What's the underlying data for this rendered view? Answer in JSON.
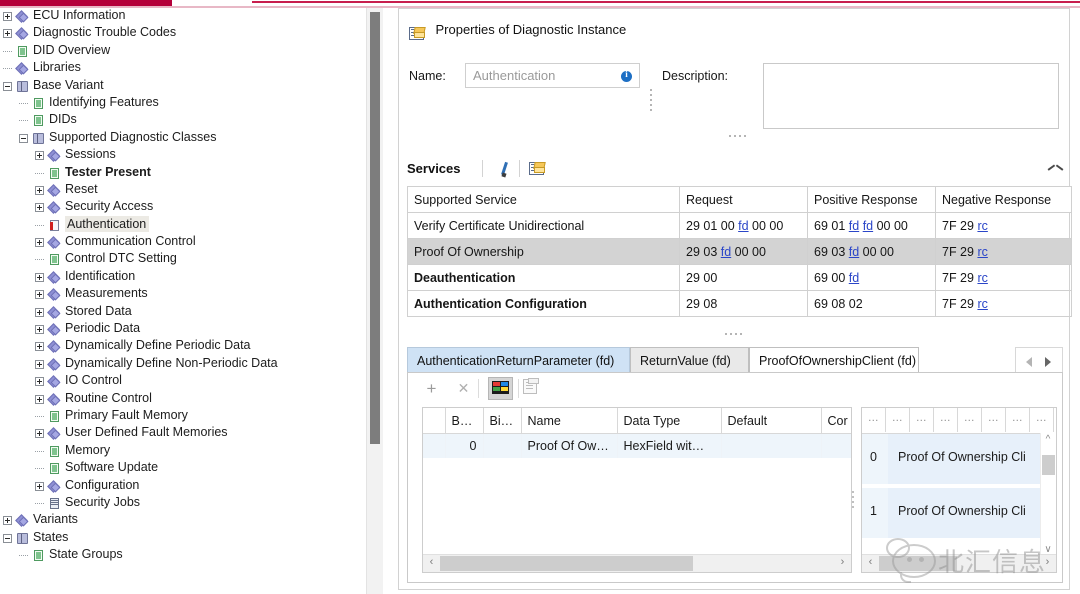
{
  "tree": {
    "items": [
      {
        "label": "ECU Information",
        "indent": 0,
        "toggle": "plus",
        "icon": "diamond-icon",
        "selected": false,
        "bold": false
      },
      {
        "label": "Diagnostic Trouble Codes",
        "indent": 0,
        "toggle": "plus",
        "icon": "diamond-icon",
        "selected": false,
        "bold": false
      },
      {
        "label": "DID Overview",
        "indent": 0,
        "toggle": "dash",
        "icon": "page-icon",
        "selected": false,
        "bold": false
      },
      {
        "label": "Libraries",
        "indent": 0,
        "toggle": "dash",
        "icon": "diamond-icon",
        "selected": false,
        "bold": false
      },
      {
        "label": "Base Variant",
        "indent": 0,
        "toggle": "minus",
        "icon": "book-icon",
        "selected": false,
        "bold": false
      },
      {
        "label": "Identifying Features",
        "indent": 1,
        "toggle": "dash",
        "icon": "page-icon",
        "selected": false,
        "bold": false
      },
      {
        "label": "DIDs",
        "indent": 1,
        "toggle": "dash",
        "icon": "page-icon",
        "selected": false,
        "bold": false
      },
      {
        "label": "Supported Diagnostic Classes",
        "indent": 1,
        "toggle": "minus",
        "icon": "book-icon",
        "selected": false,
        "bold": false
      },
      {
        "label": "Sessions",
        "indent": 2,
        "toggle": "plus",
        "icon": "diamond-icon",
        "selected": false,
        "bold": false
      },
      {
        "label": "Tester Present",
        "indent": 2,
        "toggle": "dash",
        "icon": "page-icon",
        "selected": false,
        "bold": true
      },
      {
        "label": "Reset",
        "indent": 2,
        "toggle": "plus",
        "icon": "diamond-icon",
        "selected": false,
        "bold": false
      },
      {
        "label": "Security Access",
        "indent": 2,
        "toggle": "plus",
        "icon": "diamond-icon",
        "selected": false,
        "bold": false
      },
      {
        "label": "Authentication",
        "indent": 2,
        "toggle": "dash",
        "icon": "page-red-icon",
        "selected": true,
        "bold": false
      },
      {
        "label": "Communication Control",
        "indent": 2,
        "toggle": "plus",
        "icon": "diamond-icon",
        "selected": false,
        "bold": false
      },
      {
        "label": "Control DTC Setting",
        "indent": 2,
        "toggle": "dash",
        "icon": "page-icon",
        "selected": false,
        "bold": false
      },
      {
        "label": "Identification",
        "indent": 2,
        "toggle": "plus",
        "icon": "diamond-icon",
        "selected": false,
        "bold": false
      },
      {
        "label": "Measurements",
        "indent": 2,
        "toggle": "plus",
        "icon": "diamond-icon",
        "selected": false,
        "bold": false
      },
      {
        "label": "Stored Data",
        "indent": 2,
        "toggle": "plus",
        "icon": "diamond-icon",
        "selected": false,
        "bold": false
      },
      {
        "label": "Periodic Data",
        "indent": 2,
        "toggle": "plus",
        "icon": "diamond-icon",
        "selected": false,
        "bold": false
      },
      {
        "label": "Dynamically Define Periodic Data",
        "indent": 2,
        "toggle": "plus",
        "icon": "diamond-icon",
        "selected": false,
        "bold": false
      },
      {
        "label": "Dynamically Define Non-Periodic Data",
        "indent": 2,
        "toggle": "plus",
        "icon": "diamond-icon",
        "selected": false,
        "bold": false
      },
      {
        "label": "IO Control",
        "indent": 2,
        "toggle": "plus",
        "icon": "diamond-icon",
        "selected": false,
        "bold": false
      },
      {
        "label": "Routine Control",
        "indent": 2,
        "toggle": "plus",
        "icon": "diamond-icon",
        "selected": false,
        "bold": false
      },
      {
        "label": "Primary Fault Memory",
        "indent": 2,
        "toggle": "dash",
        "icon": "page-icon",
        "selected": false,
        "bold": false
      },
      {
        "label": "User Defined Fault Memories",
        "indent": 2,
        "toggle": "plus",
        "icon": "diamond-icon",
        "selected": false,
        "bold": false
      },
      {
        "label": "Memory",
        "indent": 2,
        "toggle": "dash",
        "icon": "page-icon",
        "selected": false,
        "bold": false
      },
      {
        "label": "Software Update",
        "indent": 2,
        "toggle": "dash",
        "icon": "page-icon",
        "selected": false,
        "bold": false
      },
      {
        "label": "Configuration",
        "indent": 2,
        "toggle": "plus",
        "icon": "diamond-icon",
        "selected": false,
        "bold": false
      },
      {
        "label": "Security Jobs",
        "indent": 2,
        "toggle": "dash",
        "icon": "job-icon",
        "selected": false,
        "bold": false
      },
      {
        "label": "Variants",
        "indent": 0,
        "toggle": "plus",
        "icon": "diamond-icon",
        "selected": false,
        "bold": false
      },
      {
        "label": "States",
        "indent": 0,
        "toggle": "minus",
        "icon": "book-icon",
        "selected": false,
        "bold": false
      },
      {
        "label": "State Groups",
        "indent": 1,
        "toggle": "dash",
        "icon": "page-icon",
        "selected": false,
        "bold": false
      }
    ]
  },
  "properties": {
    "header_title": "Properties of Diagnostic Instance",
    "name_label": "Name:",
    "name_value": "Authentication",
    "description_label": "Description:",
    "description_value": ""
  },
  "services": {
    "title": "Services",
    "columns": [
      "Supported Service",
      "Request",
      "Positive Response",
      "Negative Response"
    ],
    "rows": [
      {
        "service": "Verify Certificate Unidirectional",
        "bold": false,
        "request": [
          {
            "t": "29 01 00 ",
            "l": false
          },
          {
            "t": "fd",
            "l": true
          },
          {
            "t": " 00 00",
            "l": false
          }
        ],
        "positive": [
          {
            "t": "69 01 ",
            "l": false
          },
          {
            "t": "fd",
            "l": true
          },
          {
            "t": " ",
            "l": false
          },
          {
            "t": "fd",
            "l": true
          },
          {
            "t": " 00 00",
            "l": false
          }
        ],
        "negative": [
          {
            "t": "7F 29 ",
            "l": false
          },
          {
            "t": "rc",
            "l": true
          }
        ]
      },
      {
        "service": "Proof Of Ownership",
        "bold": false,
        "request": [
          {
            "t": "29 03 ",
            "l": false
          },
          {
            "t": "fd",
            "l": true
          },
          {
            "t": " 00 00",
            "l": false
          }
        ],
        "positive": [
          {
            "t": "69 03 ",
            "l": false
          },
          {
            "t": "fd",
            "l": true
          },
          {
            "t": " 00 00",
            "l": false
          }
        ],
        "negative": [
          {
            "t": "7F 29 ",
            "l": false
          },
          {
            "t": "rc",
            "l": true
          }
        ]
      },
      {
        "service": "Deauthentication",
        "bold": true,
        "request": [
          {
            "t": "29 00",
            "l": false
          }
        ],
        "positive": [
          {
            "t": "69 00 ",
            "l": false
          },
          {
            "t": "fd",
            "l": true
          }
        ],
        "negative": [
          {
            "t": "7F 29 ",
            "l": false
          },
          {
            "t": "rc",
            "l": true
          }
        ]
      },
      {
        "service": "Authentication Configuration",
        "bold": true,
        "request": [
          {
            "t": "29 08",
            "l": false
          }
        ],
        "positive": [
          {
            "t": "69 08 02",
            "l": false
          }
        ],
        "negative": [
          {
            "t": "7F 29 ",
            "l": false
          },
          {
            "t": "rc",
            "l": true
          }
        ]
      }
    ]
  },
  "tabs": {
    "items": [
      {
        "label": "AuthenticationReturnParameter (fd)",
        "state": "highlighted"
      },
      {
        "label": "ReturnValue (fd)",
        "state": "inactive"
      },
      {
        "label": "ProofOfOwnershipClient (fd)",
        "state": "active"
      }
    ]
  },
  "param_grid": {
    "columns": [
      "",
      "B…",
      "Bi…",
      "Name",
      "Data Type",
      "Default",
      "Cor"
    ],
    "rows": [
      {
        "bit": "0",
        "name": "Proof Of Ow…",
        "data_type": "HexField wit…",
        "default": "",
        "cor": ""
      }
    ]
  },
  "value_grid": {
    "columns": [
      "…",
      "…",
      "…",
      "…",
      "…",
      "…",
      "…",
      "…"
    ],
    "rows": [
      {
        "index": "0",
        "text": "Proof Of Ownership Cli"
      },
      {
        "index": "1",
        "text": "Proof Of Ownership Cli"
      }
    ]
  },
  "watermark": {
    "text": "北汇信息"
  }
}
